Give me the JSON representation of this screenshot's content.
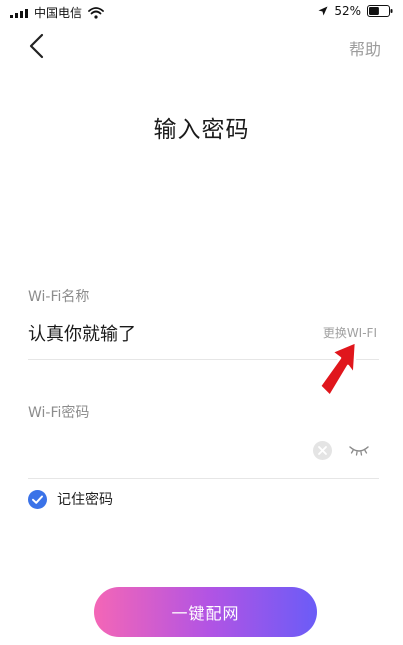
{
  "status_bar": {
    "carrier": "中国电信",
    "battery_percent": "52%",
    "battery_level": 0.52
  },
  "nav": {
    "help_label": "帮助"
  },
  "page": {
    "title": "输入密码"
  },
  "wifi_name": {
    "label": "Wi-Fi名称",
    "value": "认真你就输了",
    "change_label": "更换WI-FI"
  },
  "password": {
    "label": "Wi-Fi密码",
    "value": ""
  },
  "remember": {
    "label": "记住密码",
    "checked": true
  },
  "connect_button": {
    "label": "一键配网"
  },
  "colors": {
    "accent": "#3a72e8",
    "annotation_arrow": "#e0161c",
    "button_gradient_start": "#f466b6",
    "button_gradient_end": "#6b5cf7"
  },
  "icons": {
    "back": "chevron-left-icon",
    "clear": "clear-circle-icon",
    "visibility": "eye-closed-icon",
    "remember": "check-circle-icon",
    "annotation": "red-arrow-icon"
  }
}
